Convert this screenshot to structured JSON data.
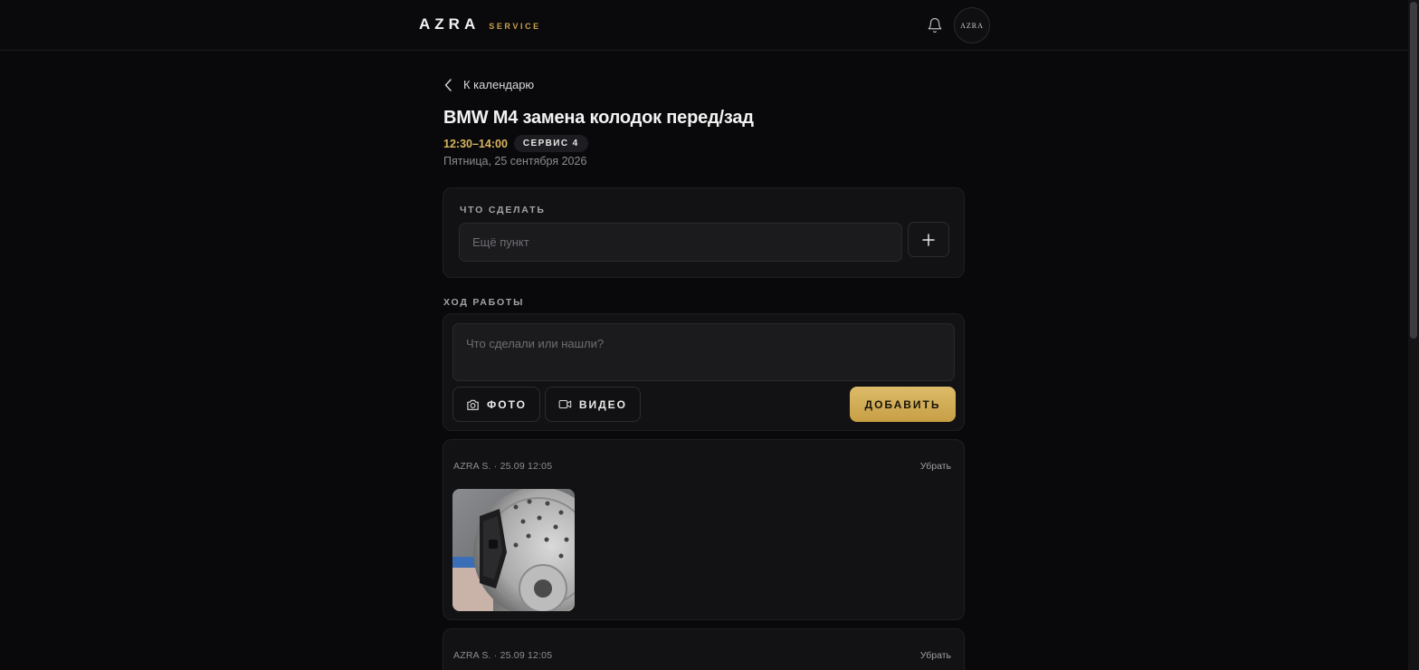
{
  "header": {
    "brand": "AZRA",
    "brand_sub": "SERVICE",
    "avatar_text": "AZRA",
    "icons": [
      "bell-icon"
    ]
  },
  "back_link": "К календарю",
  "job": {
    "title": "BMW M4 замена колодок перед/зад",
    "time": "12:30–14:00",
    "bay": "СЕРВИС 4",
    "date": "Пятница, 25 сентября 2026"
  },
  "todo": {
    "label": "ЧТО СДЕЛАТЬ",
    "placeholder": "Ещё пункт",
    "add_icon": "plus-icon"
  },
  "progress": {
    "label": "ХОД РАБОТЫ",
    "placeholder": "Что сделали или нашли?",
    "photo_label": "ФОТО",
    "video_label": "ВИДЕО",
    "submit_label": "ДОБАВИТЬ"
  },
  "entries": [
    {
      "meta": "AZRA S. · 25.09 12:05",
      "remove_label": "Убрать",
      "has_photo": true
    },
    {
      "meta": "AZRA S. · 25.09 12:05",
      "remove_label": "Убрать"
    }
  ],
  "colors": {
    "background": "#09090b",
    "accent": "#d8b55e",
    "card": "#121214"
  }
}
